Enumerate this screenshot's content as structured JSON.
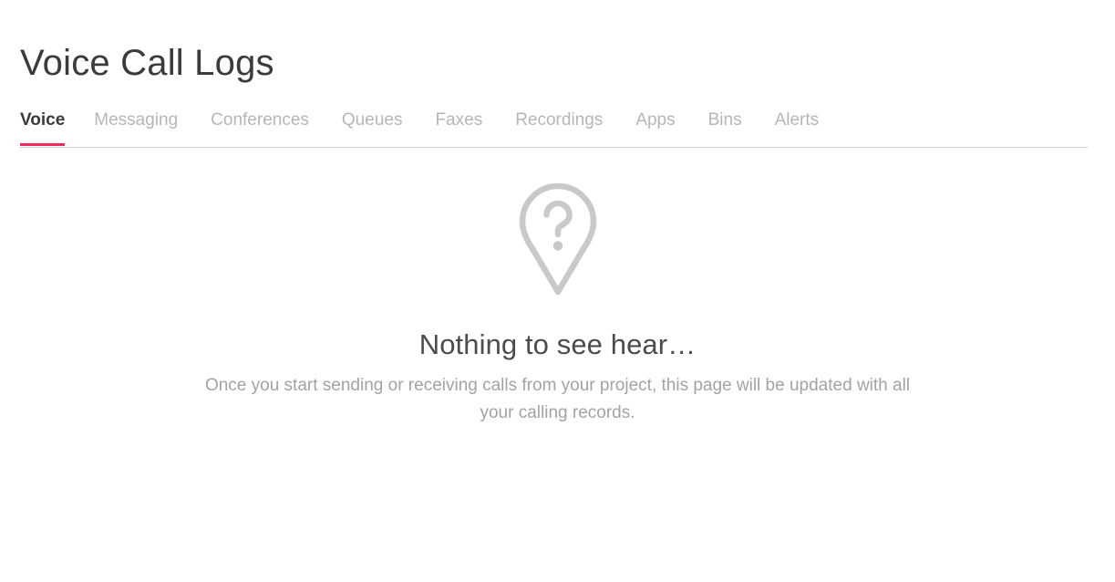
{
  "header": {
    "title": "Voice Call Logs"
  },
  "tabs": {
    "active_index": 0,
    "accent_color": "#f2295b",
    "items": [
      {
        "label": "Voice"
      },
      {
        "label": "Messaging"
      },
      {
        "label": "Conferences"
      },
      {
        "label": "Queues"
      },
      {
        "label": "Faxes"
      },
      {
        "label": "Recordings"
      },
      {
        "label": "Apps"
      },
      {
        "label": "Bins"
      },
      {
        "label": "Alerts"
      }
    ]
  },
  "empty_state": {
    "icon": "map-pin-question-icon",
    "icon_color": "#c9c9c9",
    "heading": "Nothing to see hear…",
    "description_line1": "Once you start sending or receiving calls from your project, this page will be",
    "description_line2": "updated with all your calling records.",
    "description": "Once you start sending or receiving calls from your project, this page will be updated with all your calling records."
  }
}
